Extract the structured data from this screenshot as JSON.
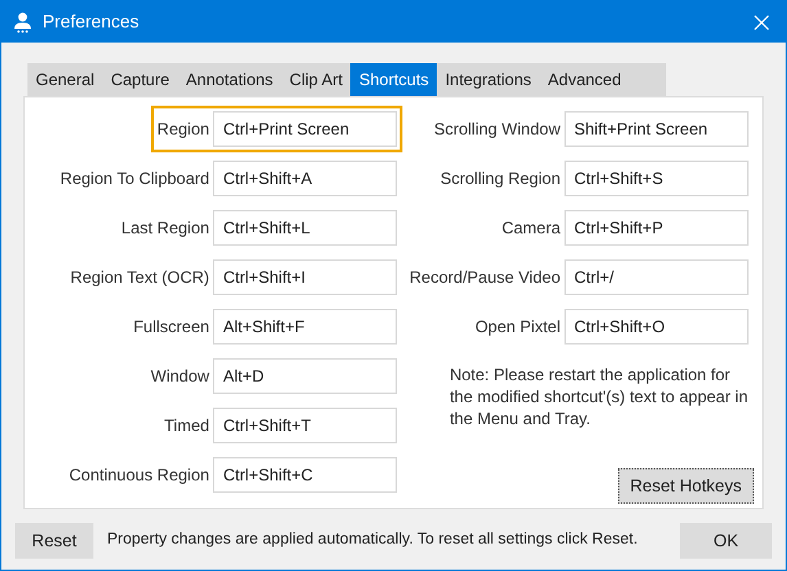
{
  "window": {
    "title": "Preferences"
  },
  "tabs": [
    {
      "label": "General",
      "selected": false
    },
    {
      "label": "Capture",
      "selected": false
    },
    {
      "label": "Annotations",
      "selected": false
    },
    {
      "label": "Clip Art",
      "selected": false
    },
    {
      "label": "Shortcuts",
      "selected": true
    },
    {
      "label": "Integrations",
      "selected": false
    },
    {
      "label": "Advanced",
      "selected": false
    }
  ],
  "shortcuts_left": [
    {
      "label": "Region",
      "value": "Ctrl+Print Screen",
      "focused": true
    },
    {
      "label": "Region To Clipboard",
      "value": "Ctrl+Shift+A",
      "focused": false
    },
    {
      "label": "Last Region",
      "value": "Ctrl+Shift+L",
      "focused": false
    },
    {
      "label": "Region Text (OCR)",
      "value": "Ctrl+Shift+I",
      "focused": false
    },
    {
      "label": "Fullscreen",
      "value": "Alt+Shift+F",
      "focused": false
    },
    {
      "label": "Window",
      "value": "Alt+D",
      "focused": false
    },
    {
      "label": "Timed",
      "value": "Ctrl+Shift+T",
      "focused": false
    },
    {
      "label": "Continuous Region",
      "value": "Ctrl+Shift+C",
      "focused": false
    }
  ],
  "shortcuts_right": [
    {
      "label": "Scrolling Window",
      "value": "Shift+Print Screen",
      "focused": false
    },
    {
      "label": "Scrolling Region",
      "value": "Ctrl+Shift+S",
      "focused": false
    },
    {
      "label": "Camera",
      "value": "Ctrl+Shift+P",
      "focused": false
    },
    {
      "label": "Record/Pause Video",
      "value": "Ctrl+/",
      "focused": false
    },
    {
      "label": "Open Pixtel",
      "value": "Ctrl+Shift+O",
      "focused": false
    }
  ],
  "note": "Note: Please restart the application for the modified shortcut'(s) text to appear in the Menu and Tray.",
  "reset_hotkeys_button": {
    "label": "Reset Hotkeys",
    "focused": true
  },
  "footer": {
    "reset_button": "Reset",
    "message": "Property changes are applied automatically. To reset all settings click Reset.",
    "ok_button": "OK"
  }
}
